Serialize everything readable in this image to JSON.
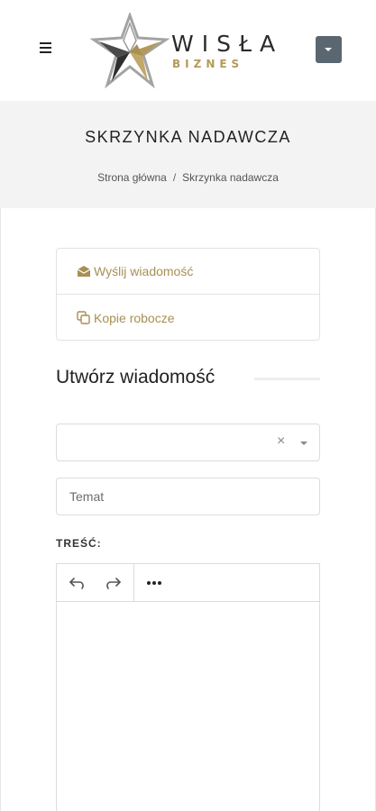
{
  "header": {
    "logo": {
      "title": "WISŁA",
      "subtitle": "BIZNES",
      "colors": {
        "gold": "#b39a58",
        "dark": "#2b2b2b",
        "grey": "#9a9a9a"
      }
    },
    "menu_icon": "hamburger-icon",
    "user_menu_icon": "caret-down-icon"
  },
  "title_band": {
    "title": "SKRZYNKA NADAWCZA",
    "breadcrumb": {
      "home": "Strona główna",
      "separator": "/",
      "current": "Skrzynka nadawcza"
    }
  },
  "mail_menu": {
    "items": [
      {
        "label": "Wyślij wiadomość",
        "icon": "envelope-open-icon"
      },
      {
        "label": "Kopie robocze",
        "icon": "copy-icon"
      }
    ],
    "accent_color": "#a88f52"
  },
  "compose": {
    "heading": "Utwórz wiadomość",
    "recipient": {
      "value": "",
      "clear_symbol": "×"
    },
    "subject": {
      "placeholder": "Temat",
      "value": ""
    },
    "body_label": "TREŚĆ:",
    "toolbar": {
      "undo_icon": "undo-icon",
      "redo_icon": "redo-icon",
      "more_icon": "more-horizontal-icon"
    }
  }
}
